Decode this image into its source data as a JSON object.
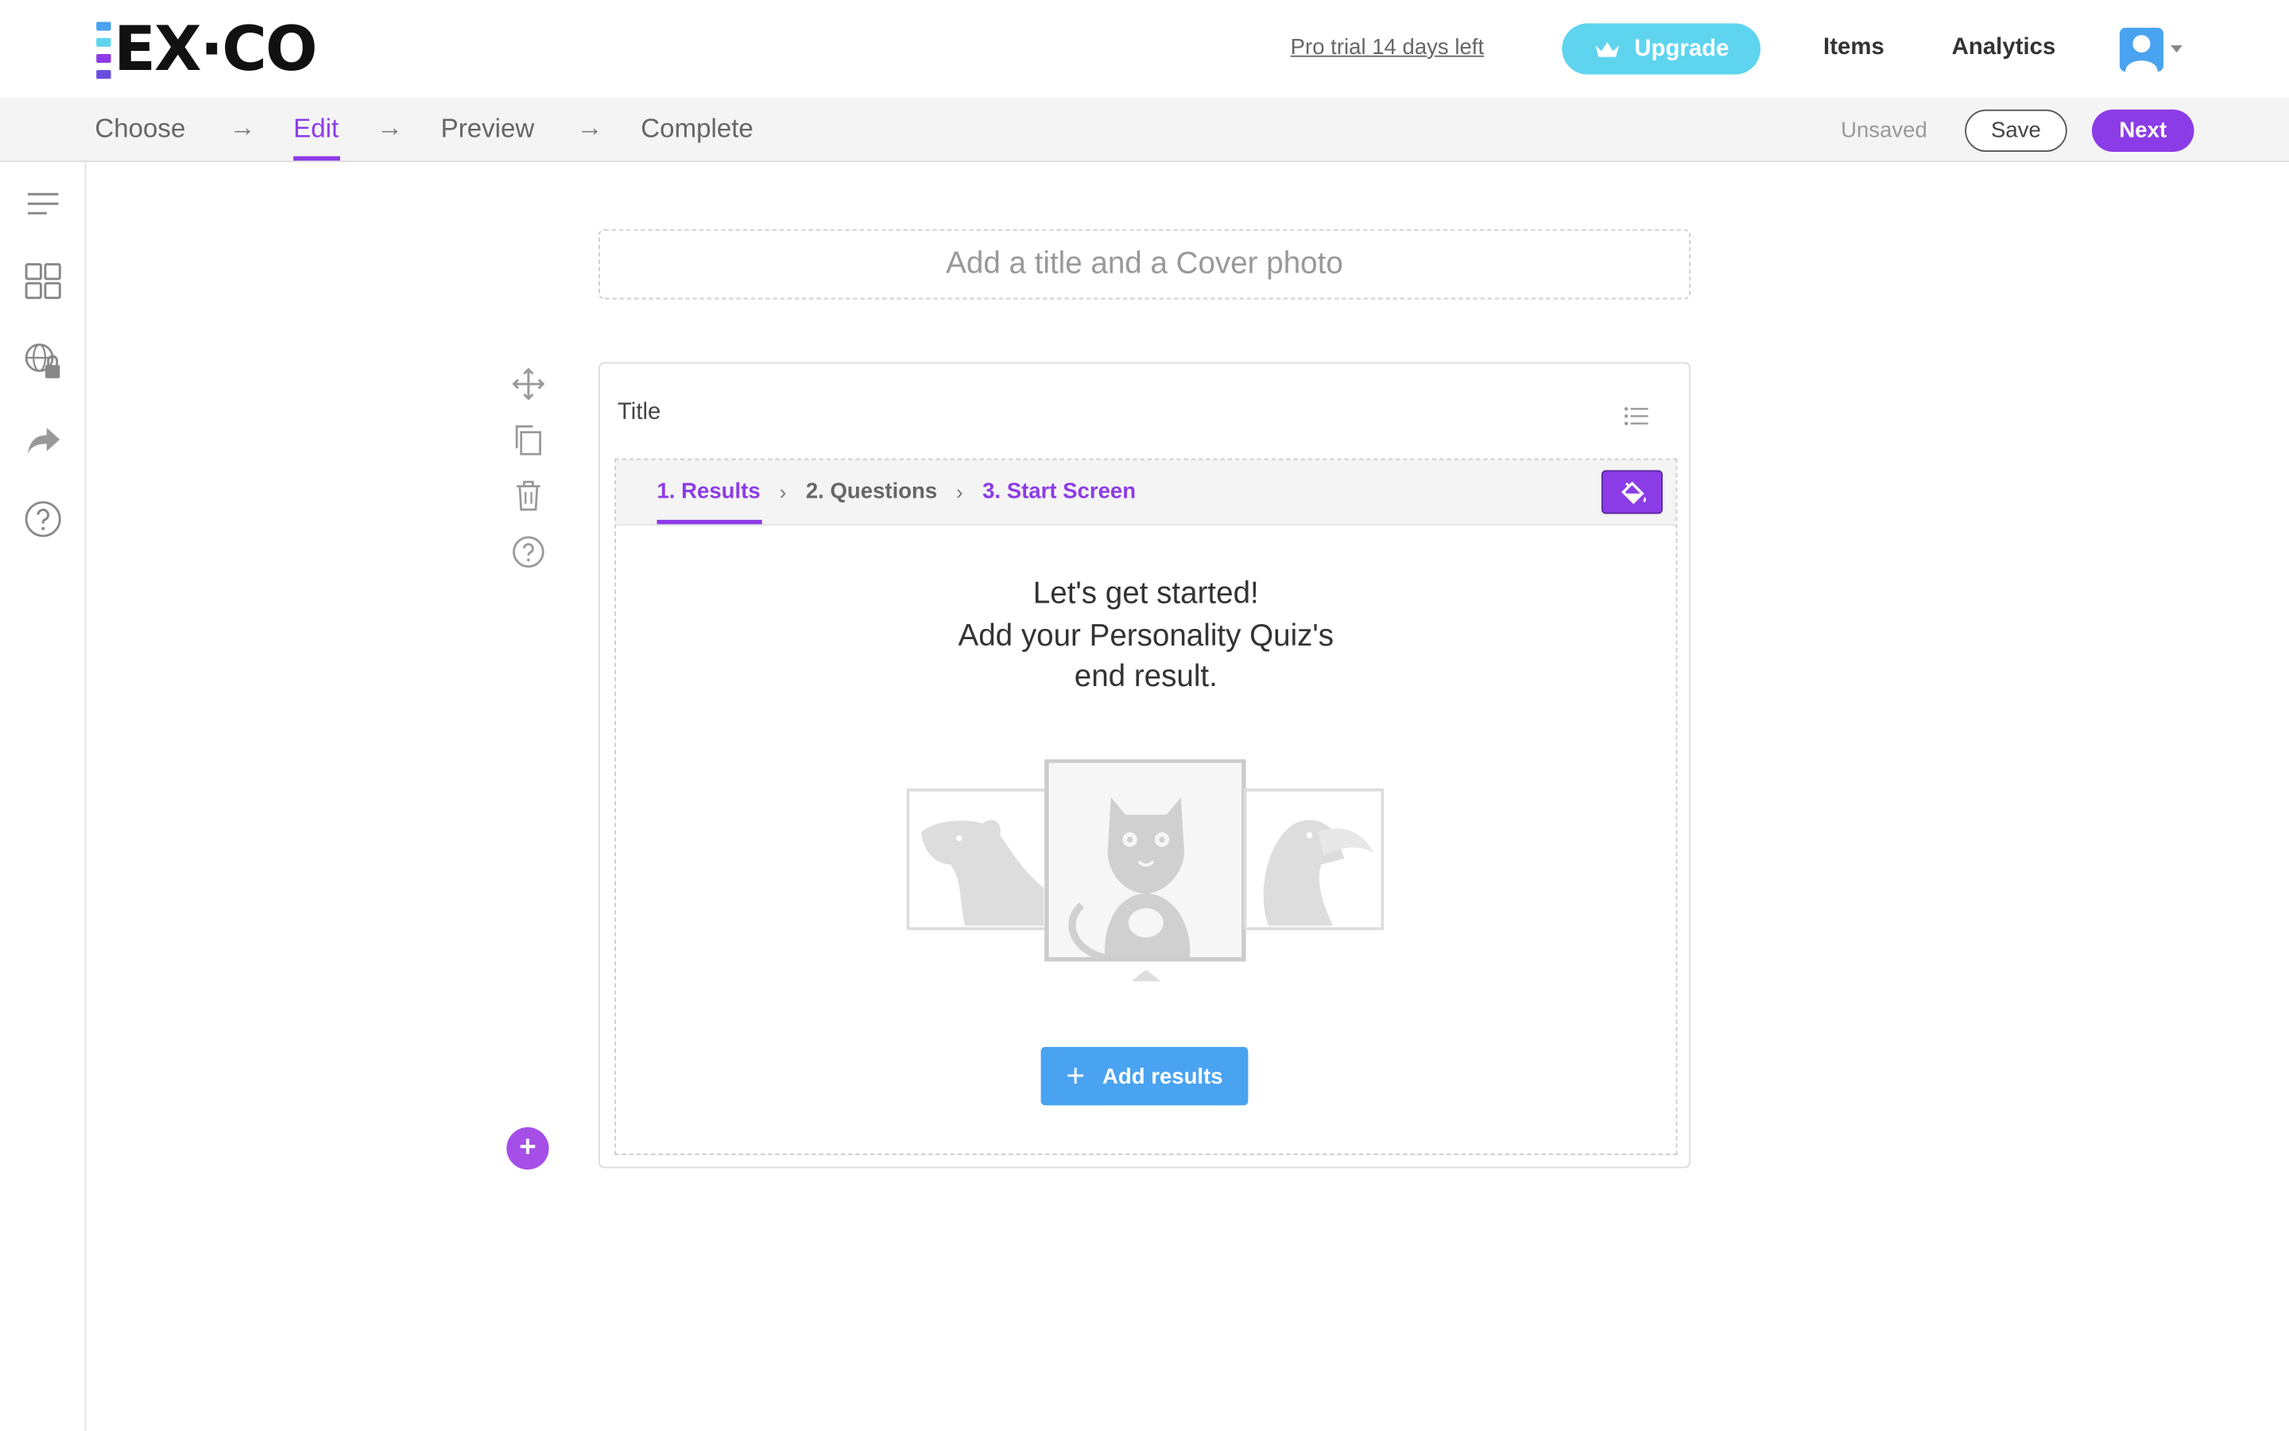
{
  "header": {
    "logo_text": "EX·CO",
    "logo_bar_colors": [
      "#4aa3f0",
      "#5fd4ee",
      "#8c3ce6",
      "#6a4ee0"
    ],
    "pro_trial": "Pro trial 14 days left",
    "upgrade_label": "Upgrade",
    "nav": {
      "items": "Items",
      "analytics": "Analytics"
    }
  },
  "steps": {
    "items": [
      "Choose",
      "Edit",
      "Preview",
      "Complete"
    ],
    "active": "Edit",
    "arrow": "→",
    "unsaved": "Unsaved",
    "save": "Save",
    "next": "Next"
  },
  "left_rail": {
    "icons": [
      "menu-icon",
      "grid-icon",
      "globe-lock-icon",
      "share-icon",
      "help-icon"
    ]
  },
  "editor": {
    "cover_placeholder": "Add a title and a Cover photo",
    "tools": [
      "move-icon",
      "copy-icon",
      "trash-icon",
      "help-icon"
    ],
    "card": {
      "title": "Title",
      "tabs": {
        "results": "1. Results",
        "questions": "2. Questions",
        "start_screen": "3. Start Screen",
        "separator": "›"
      },
      "headline_line1": "Let's get started!",
      "headline_line2": "Add your Personality Quiz's",
      "headline_line3": "end result.",
      "add_results": "Add results",
      "add_results_icon": "+"
    },
    "add_block_icon": "+"
  },
  "colors": {
    "accent_purple": "#8c3ce6",
    "upgrade_cyan": "#5fd4ee",
    "button_blue": "#4aa3f0"
  }
}
